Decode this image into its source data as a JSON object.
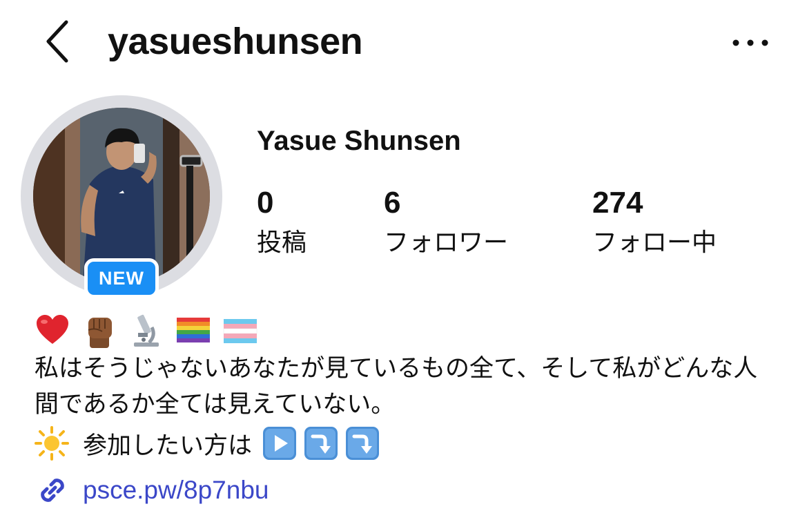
{
  "header": {
    "username": "yasueshunsen",
    "back_icon": "chevron-left-icon",
    "more_icon": "more-horizontal-icon"
  },
  "profile": {
    "full_name": "Yasue Shunsen",
    "avatar_badge": "NEW",
    "badge_color": "#1a8ff5",
    "stats": [
      {
        "value": "0",
        "label": "投稿"
      },
      {
        "value": "6",
        "label": "フォロワー"
      },
      {
        "value": "274",
        "label": "フォロー中"
      }
    ]
  },
  "bio": {
    "emojis": [
      "red-heart-icon",
      "raised-fist-icon",
      "microscope-icon",
      "rainbow-flag-icon",
      "transgender-flag-icon"
    ],
    "text": "私はそうじゃないあなたが見ているもの全て、そして私がどんな人間であるか全ては見えていない。",
    "join_line": {
      "icon": "sun-icon",
      "text": "参加したい方は",
      "arrows": [
        "play-button-icon",
        "arrow-down-right-icon",
        "arrow-down-right-icon"
      ]
    },
    "link": {
      "icon": "link-icon",
      "text": "psce.pw/8p7nbu",
      "color": "#3b47c8"
    }
  }
}
